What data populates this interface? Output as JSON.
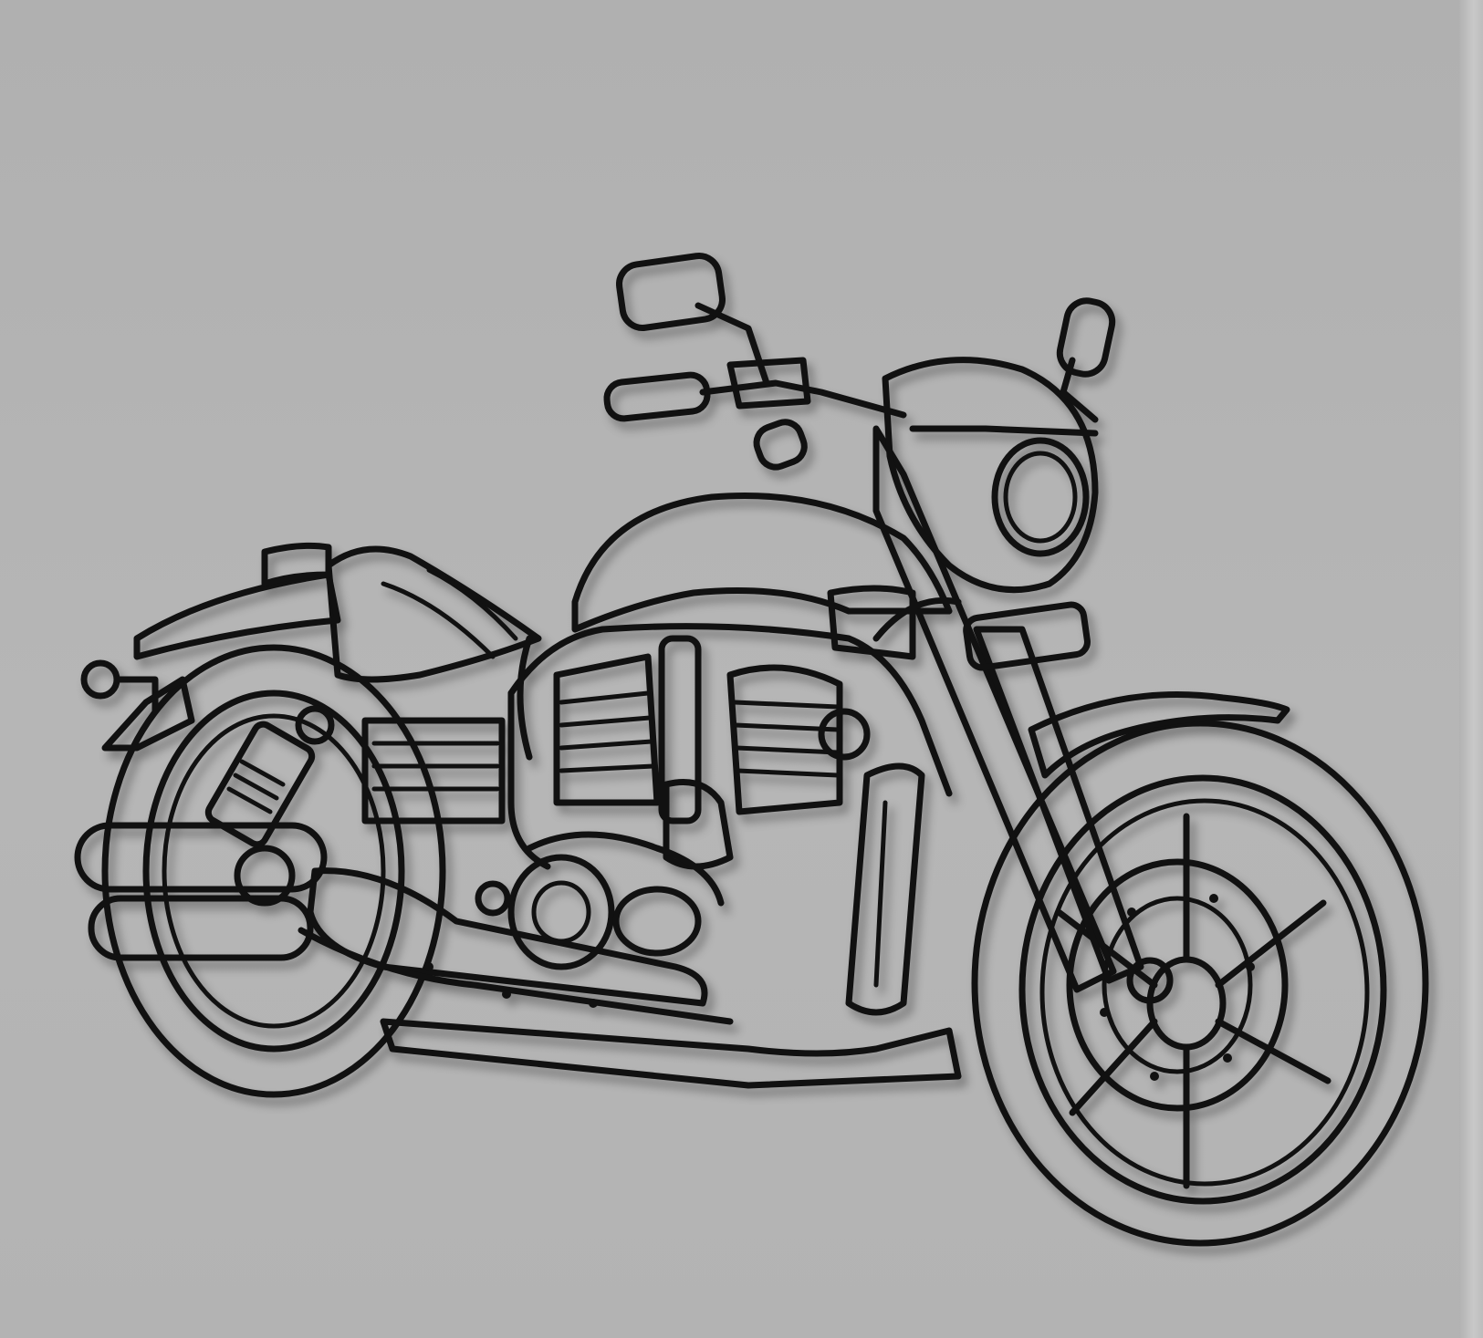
{
  "scene": {
    "subject": "motorcycle-line-art-wall-decor",
    "colors": {
      "background": "#b4b4b4",
      "line": "#111111"
    }
  }
}
